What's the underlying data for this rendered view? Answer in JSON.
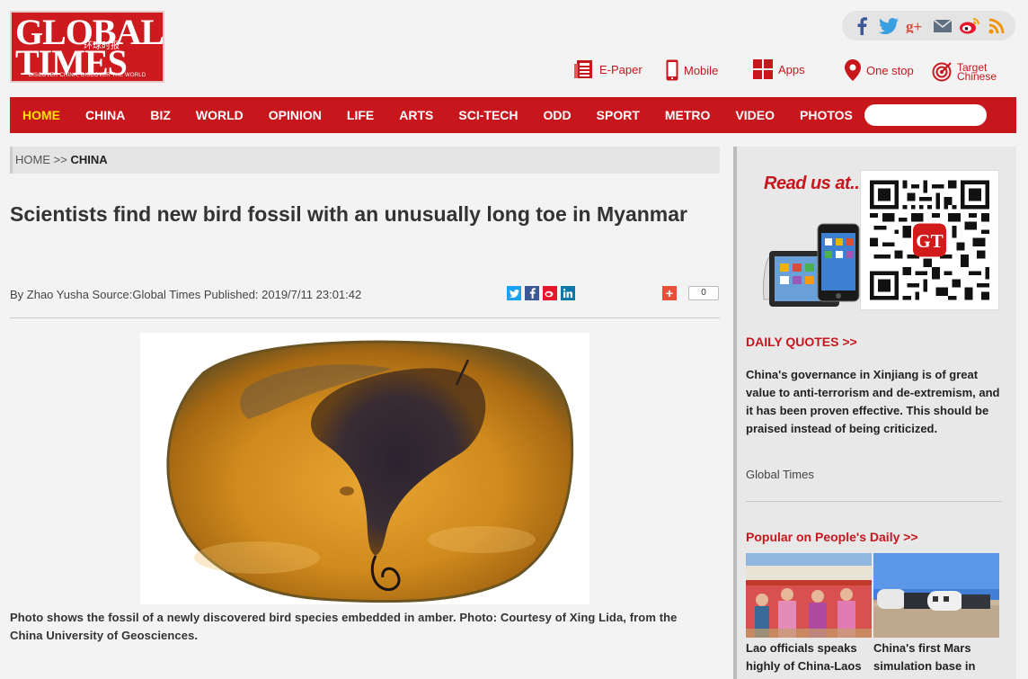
{
  "brand": {
    "line1": "GLOBAL",
    "line2": "TIMES",
    "cn": "环球时报",
    "tagline": "DISCOVER CHINA, DISCOVER THE WORLD"
  },
  "social_icons": [
    "facebook-icon",
    "twitter-icon",
    "google-plus-icon",
    "email-icon",
    "weibo-icon",
    "rss-icon"
  ],
  "topnav": {
    "epaper": "E-Paper",
    "mobile": "Mobile",
    "apps": "Apps",
    "onestop": "One stop",
    "target_l1": "Target",
    "target_l2": "Chinese"
  },
  "nav": [
    "HOME",
    "CHINA",
    "BIZ",
    "WORLD",
    "OPINION",
    "LIFE",
    "ARTS",
    "SCI-TECH",
    "ODD",
    "SPORT",
    "METRO",
    "VIDEO",
    "PHOTOS"
  ],
  "active_nav": "HOME",
  "search": {
    "placeholder": ""
  },
  "breadcrumb": {
    "home": "HOME",
    "sep": ">>",
    "current": "CHINA"
  },
  "article": {
    "title": "Scientists find new bird fossil with an unusually long toe in Myanmar",
    "byline": "By Zhao Yusha Source:Global Times Published: 2019/7/11 23:01:42",
    "share_count": "0",
    "caption": "Photo shows the fossil of a newly discovered bird species embedded in amber. Photo: Courtesy of Xing Lida, from the China University of Geosciences."
  },
  "sidebar": {
    "read_us": "Read us at...",
    "daily_quotes_title": "DAILY QUOTES >>",
    "quote": "China's governance in Xinjiang is of great value to anti-terrorism and de-extremism, and it has been proven effective. This should be praised instead of being criticized.",
    "quote_source": "Global Times",
    "popular_title": "Popular on People's Daily >>",
    "popular": [
      {
        "caption": "Lao officials speaks highly of China-Laos"
      },
      {
        "caption": "China's first Mars simulation base in"
      }
    ]
  },
  "colors": {
    "brand_red": "#c8161d",
    "active_nav": "#ffe100",
    "amber": "#d8931c"
  }
}
